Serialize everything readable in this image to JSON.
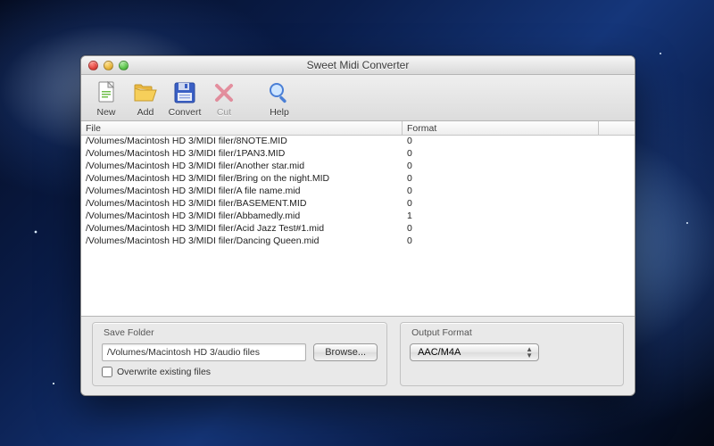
{
  "window": {
    "title": "Sweet Midi Converter"
  },
  "toolbar": {
    "new": {
      "label": "New"
    },
    "add": {
      "label": "Add"
    },
    "convert": {
      "label": "Convert"
    },
    "cut": {
      "label": "Cut"
    },
    "help": {
      "label": "Help"
    }
  },
  "columns": {
    "file": "File",
    "format": "Format"
  },
  "rows": [
    {
      "file": "/Volumes/Macintosh HD 3/MIDI filer/8NOTE.MID",
      "format": "0"
    },
    {
      "file": "/Volumes/Macintosh HD 3/MIDI filer/1PAN3.MID",
      "format": "0"
    },
    {
      "file": "/Volumes/Macintosh HD 3/MIDI filer/Another star.mid",
      "format": "0"
    },
    {
      "file": "/Volumes/Macintosh HD 3/MIDI filer/Bring on the night.MID",
      "format": "0"
    },
    {
      "file": "/Volumes/Macintosh HD 3/MIDI filer/A file name.mid",
      "format": "0"
    },
    {
      "file": "/Volumes/Macintosh HD 3/MIDI filer/BASEMENT.MID",
      "format": "0"
    },
    {
      "file": "/Volumes/Macintosh HD 3/MIDI filer/Abbamedly.mid",
      "format": "1"
    },
    {
      "file": "/Volumes/Macintosh HD 3/MIDI filer/Acid Jazz Test#1.mid",
      "format": "0"
    },
    {
      "file": "/Volumes/Macintosh HD 3/MIDI filer/Dancing Queen.mid",
      "format": "0"
    }
  ],
  "save_panel": {
    "title": "Save Folder",
    "path": "/Volumes/Macintosh HD 3/audio files",
    "browse_label": "Browse...",
    "overwrite_label": "Overwrite existing files",
    "overwrite_checked": false
  },
  "output_panel": {
    "title": "Output Format",
    "selected": "AAC/M4A"
  }
}
